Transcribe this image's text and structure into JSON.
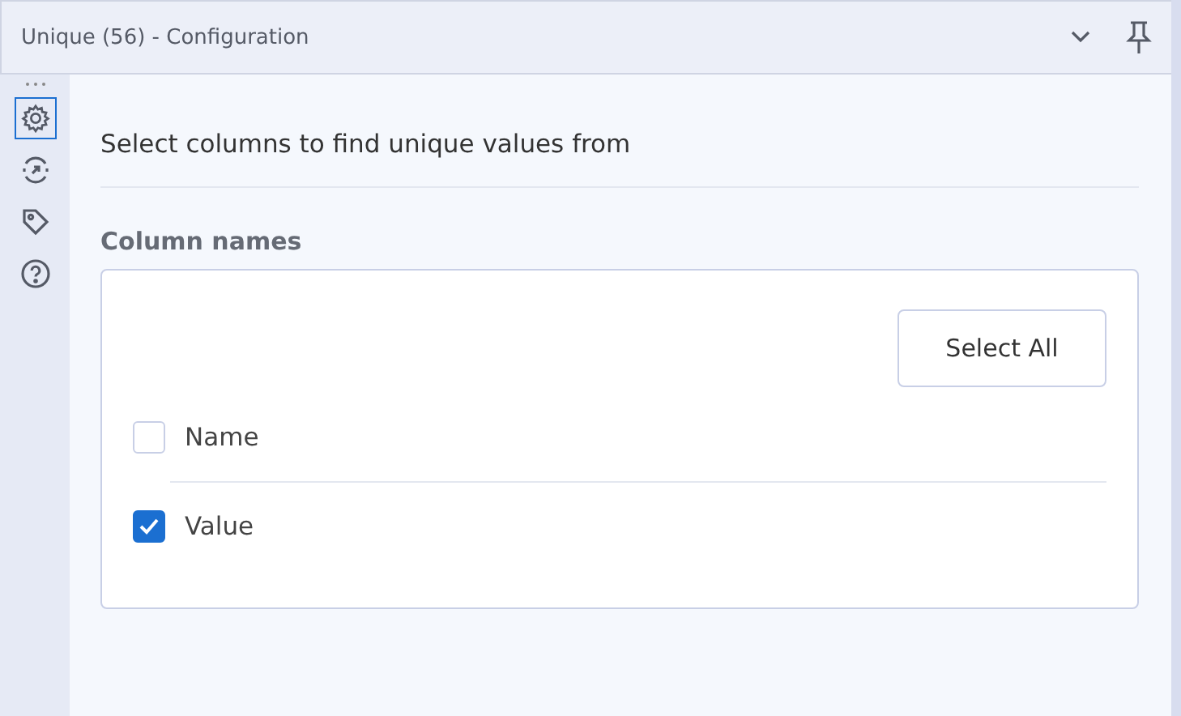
{
  "window": {
    "title": "Unique (56) - Configuration"
  },
  "sidebar": {
    "items": [
      {
        "kind": "gear",
        "selected": true
      },
      {
        "kind": "connect",
        "selected": false
      },
      {
        "kind": "tag",
        "selected": false
      },
      {
        "kind": "help",
        "selected": false
      }
    ]
  },
  "instruction": "Select columns to find unique values from",
  "column_list": {
    "label": "Column names",
    "select_all": "Select All",
    "columns": [
      {
        "name": "Name",
        "checked": false
      },
      {
        "name": "Value",
        "checked": true
      }
    ]
  }
}
